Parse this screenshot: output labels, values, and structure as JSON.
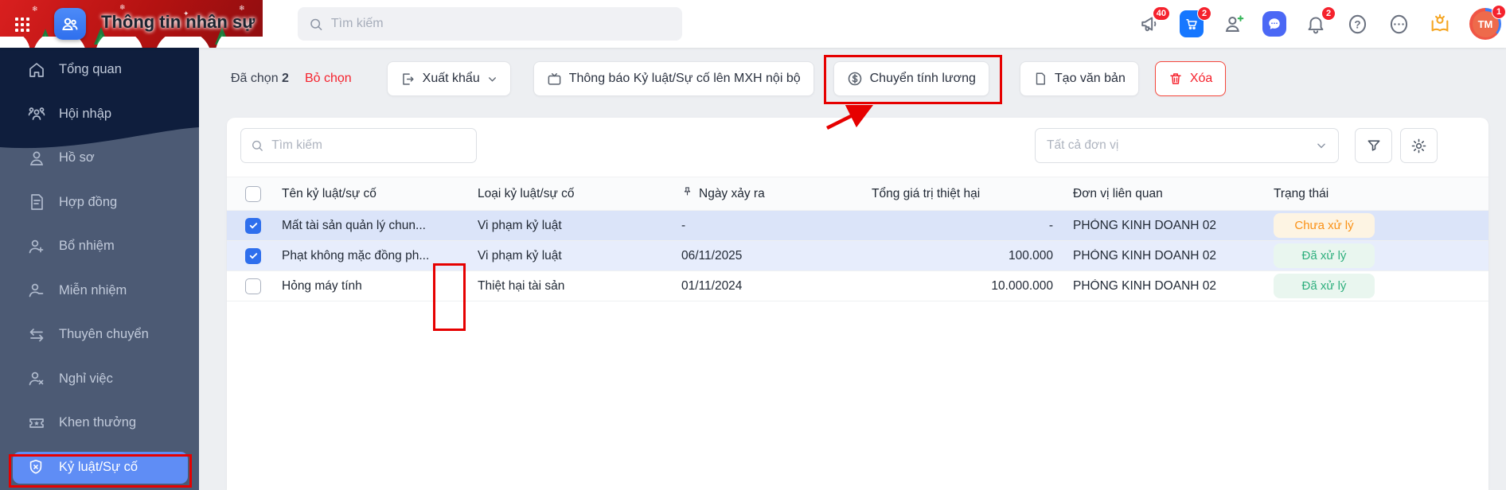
{
  "topbar": {
    "title": "Thông tin nhân sự",
    "search_placeholder": "Tìm kiếm",
    "badges": {
      "megaphone": "40",
      "cart": "2",
      "bell": "2",
      "avatar": "1"
    },
    "avatar_text": "TM"
  },
  "sidebar": {
    "items": [
      {
        "label": "Tổng quan",
        "icon": "home"
      },
      {
        "label": "Hội nhập",
        "icon": "people-group"
      },
      {
        "label": "Hồ sơ",
        "icon": "person"
      },
      {
        "label": "Hợp đồng",
        "icon": "contract-file"
      },
      {
        "label": "Bổ nhiệm",
        "icon": "person-plus"
      },
      {
        "label": "Miễn nhiệm",
        "icon": "person-minus"
      },
      {
        "label": "Thuyên chuyển",
        "icon": "transfer-arrows"
      },
      {
        "label": "Nghỉ việc",
        "icon": "person-x"
      },
      {
        "label": "Khen thưởng",
        "icon": "award-ticket"
      },
      {
        "label": "Kỷ luật/Sự cố",
        "icon": "shield-x",
        "active": true
      }
    ]
  },
  "toolbar": {
    "selected_label": "Đã chọn",
    "selected_count": "2",
    "clear_label": "Bỏ chọn",
    "export_label": "Xuất khẩu",
    "notify_label": "Thông báo Kỷ luật/Sự cố lên MXH nội bộ",
    "payroll_label": "Chuyển tính lương",
    "create_doc_label": "Tạo văn bản",
    "delete_label": "Xóa"
  },
  "filters": {
    "search_placeholder": "Tìm kiếm",
    "unit_placeholder": "Tất cả đơn vị"
  },
  "table": {
    "columns": {
      "name": "Tên kỷ luật/sự cố",
      "type": "Loại kỷ luật/sự cố",
      "date": "Ngày xảy ra",
      "value": "Tổng giá trị thiệt hại",
      "unit": "Đơn vị liên quan",
      "status": "Trạng thái"
    },
    "rows": [
      {
        "checked": true,
        "name": "Mất tài sản quản lý chun...",
        "type": "Vi phạm kỷ luật",
        "date": "-",
        "value": "-",
        "unit": "PHÒNG KINH DOANH 02",
        "status": "Chưa xử lý",
        "status_kind": "pending"
      },
      {
        "checked": true,
        "name": "Phạt không mặc đồng ph...",
        "type": "Vi phạm kỷ luật",
        "date": "06/11/2025",
        "value": "100.000",
        "unit": "PHÒNG KINH DOANH 02",
        "status": "Đã xử lý",
        "status_kind": "done"
      },
      {
        "checked": false,
        "name": "Hỏng máy tính",
        "type": "Thiệt hại tài sản",
        "date": "01/11/2024",
        "value": "10.000.000",
        "unit": "PHÒNG KINH DOANH 02",
        "status": "Đã xử lý",
        "status_kind": "done"
      }
    ]
  },
  "colors": {
    "accent_blue": "#2f6fed",
    "sidebar_active": "#5f8df5",
    "annotation_red": "#e60000",
    "status_pending_text": "#fa9116",
    "status_pending_bg": "#fdf4e3",
    "status_done_text": "#2eaf7d",
    "status_done_bg": "#e9f6ef",
    "danger_red": "#f5222d"
  }
}
